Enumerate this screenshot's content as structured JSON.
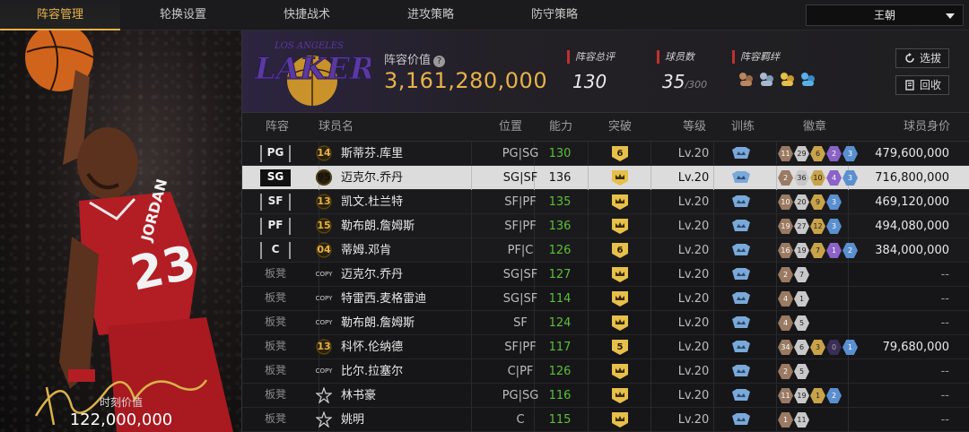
{
  "nav": {
    "tabs": [
      "阵容管理",
      "轮换设置",
      "快捷战术",
      "进攻策略",
      "防守策略"
    ],
    "active_tab": 0,
    "team_select": "王朝"
  },
  "card": {
    "moment_label": "时刻价值",
    "moment_value": "122,000,000"
  },
  "header": {
    "value_label": "阵容价值",
    "value": "3,161,280,000",
    "rating_label": "阵容总评",
    "rating": "130",
    "players_label": "球员数",
    "players": "35",
    "players_max": "/300",
    "bonds_label": "阵容羁绊",
    "scout_button": "选拔",
    "recycle_button": "回收",
    "accent_color": "#e6b24a"
  },
  "columns": [
    "阵容",
    "球员名",
    "位置",
    "能力",
    "突破",
    "等级",
    "训练",
    "徽章",
    "球员身价"
  ],
  "rows": [
    {
      "slot": "PG",
      "num": "14",
      "name": "斯蒂芬.库里",
      "pos": "PG|SG",
      "ability": "130",
      "bt": "6",
      "level": "Lv.20",
      "badges": [
        [
          "11",
          "bronze"
        ],
        [
          "29",
          "silver"
        ],
        [
          "6",
          "gold"
        ],
        [
          "2",
          "purple"
        ],
        [
          "3",
          "blue"
        ]
      ],
      "salary": "479,600,000"
    },
    {
      "slot": "SG",
      "num": "95",
      "name": "迈克尔.乔丹",
      "pos": "SG|SF",
      "ability": "136",
      "bt": "crown",
      "level": "Lv.20",
      "badges": [
        [
          "2",
          "bronze"
        ],
        [
          "36",
          "silver"
        ],
        [
          "10",
          "gold"
        ],
        [
          "4",
          "purple"
        ],
        [
          "3",
          "blue"
        ]
      ],
      "salary": "716,800,000"
    },
    {
      "slot": "SF",
      "num": "13",
      "name": "凯文.杜兰特",
      "pos": "SF|PF",
      "ability": "135",
      "bt": "crown",
      "level": "Lv.20",
      "badges": [
        [
          "10",
          "bronze"
        ],
        [
          "20",
          "silver"
        ],
        [
          "9",
          "gold"
        ],
        [
          "3",
          "blue"
        ]
      ],
      "salary": "469,120,000"
    },
    {
      "slot": "PF",
      "num": "15",
      "name": "勒布朗.詹姆斯",
      "pos": "SF|PF",
      "ability": "136",
      "bt": "crown",
      "level": "Lv.20",
      "badges": [
        [
          "19",
          "bronze"
        ],
        [
          "27",
          "silver"
        ],
        [
          "12",
          "gold"
        ],
        [
          "3",
          "blue"
        ]
      ],
      "salary": "494,080,000"
    },
    {
      "slot": "C",
      "num": "04",
      "name": "蒂姆.邓肯",
      "pos": "PF|C",
      "ability": "126",
      "bt": "6",
      "level": "Lv.20",
      "badges": [
        [
          "16",
          "bronze"
        ],
        [
          "19",
          "silver"
        ],
        [
          "7",
          "gold"
        ],
        [
          "1",
          "purple"
        ],
        [
          "2",
          "blue"
        ]
      ],
      "salary": "384,000,000"
    },
    {
      "slot": "板凳",
      "num": "COPY",
      "name": "迈克尔.乔丹",
      "pos": "SG|SF",
      "ability": "127",
      "bt": "crown",
      "level": "Lv.20",
      "badges": [
        [
          "2",
          "bronze"
        ],
        [
          "7",
          "silver"
        ]
      ],
      "salary": "--"
    },
    {
      "slot": "板凳",
      "num": "COPY",
      "name": "特雷西.麦格雷迪",
      "pos": "SG|SF",
      "ability": "114",
      "bt": "crown",
      "level": "Lv.20",
      "badges": [
        [
          "4",
          "bronze"
        ],
        [
          "1",
          "silver"
        ]
      ],
      "salary": "--"
    },
    {
      "slot": "板凳",
      "num": "COPY",
      "name": "勒布朗.詹姆斯",
      "pos": "SF",
      "ability": "124",
      "bt": "crown",
      "level": "Lv.20",
      "badges": [
        [
          "4",
          "bronze"
        ],
        [
          "5",
          "silver"
        ]
      ],
      "salary": "--"
    },
    {
      "slot": "板凳",
      "num": "13",
      "name": "科怀.伦纳德",
      "pos": "SF|PF",
      "ability": "117",
      "bt": "5",
      "level": "Lv.20",
      "badges": [
        [
          "34",
          "bronze"
        ],
        [
          "6",
          "silver"
        ],
        [
          "3",
          "gold"
        ],
        [
          "0",
          "dark"
        ],
        [
          "1",
          "blue"
        ]
      ],
      "salary": "79,680,000"
    },
    {
      "slot": "板凳",
      "num": "COPY",
      "name": "比尔.拉塞尔",
      "pos": "C|PF",
      "ability": "126",
      "bt": "crown",
      "level": "Lv.20",
      "badges": [
        [
          "2",
          "bronze"
        ],
        [
          "5",
          "silver"
        ]
      ],
      "salary": "--"
    },
    {
      "slot": "板凳",
      "num": "star",
      "name": "林书豪",
      "pos": "PG|SG",
      "ability": "116",
      "bt": "crown",
      "level": "Lv.20",
      "badges": [
        [
          "11",
          "bronze"
        ],
        [
          "19",
          "silver"
        ],
        [
          "1",
          "gold"
        ],
        [
          "2",
          "blue"
        ]
      ],
      "salary": "--"
    },
    {
      "slot": "板凳",
      "num": "star",
      "name": "姚明",
      "pos": "C",
      "ability": "115",
      "bt": "crown",
      "level": "Lv.20",
      "badges": [
        [
          "1",
          "bronze"
        ],
        [
          "11",
          "silver"
        ]
      ],
      "salary": "--"
    }
  ]
}
